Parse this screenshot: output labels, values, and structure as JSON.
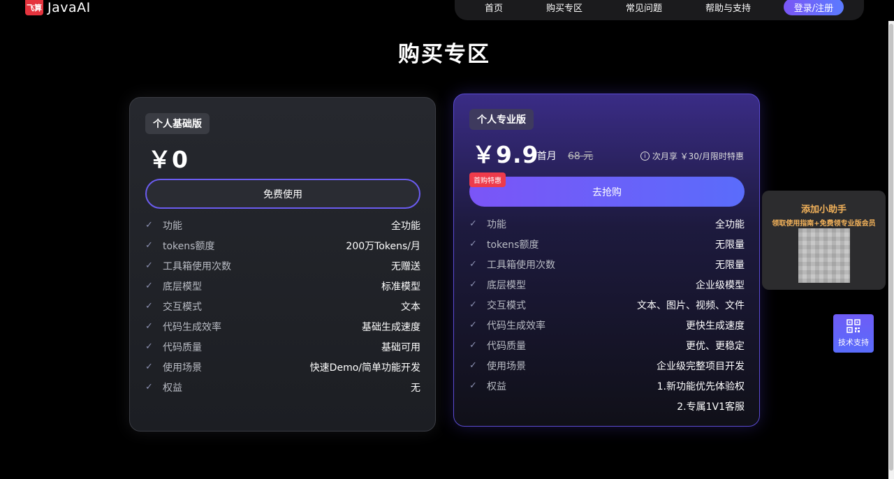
{
  "header": {
    "logo_badge": "飞算",
    "logo_text": "JavaAI",
    "nav": [
      "首页",
      "购买专区",
      "常见问题",
      "帮助与支持"
    ],
    "login_label": "登录/注册"
  },
  "page_title": "购买专区",
  "basic": {
    "tag": "个人基础版",
    "price": "￥0",
    "button": "免费使用",
    "features": [
      {
        "label": "功能",
        "value": "全功能"
      },
      {
        "label": "tokens额度",
        "value": "200万Tokens/月"
      },
      {
        "label": "工具箱使用次数",
        "value": "无赠送"
      },
      {
        "label": "底层模型",
        "value": "标准模型"
      },
      {
        "label": "交互模式",
        "value": "文本"
      },
      {
        "label": "代码生成效率",
        "value": "基础生成速度"
      },
      {
        "label": "代码质量",
        "value": "基础可用"
      },
      {
        "label": "使用场景",
        "value": "快速Demo/简单功能开发"
      },
      {
        "label": "权益",
        "value": "无"
      }
    ]
  },
  "pro": {
    "tag": "个人专业版",
    "price": "￥9.9",
    "price_unit": "/首月",
    "price_old": "68 元",
    "price_note": "次月享 ￥30/月限时特惠",
    "badge": "首购特惠",
    "button": "去抢购",
    "features": [
      {
        "label": "功能",
        "value": "全功能"
      },
      {
        "label": "tokens额度",
        "value": "无限量"
      },
      {
        "label": "工具箱使用次数",
        "value": "无限量"
      },
      {
        "label": "底层模型",
        "value": "企业级模型"
      },
      {
        "label": "交互模式",
        "value": "文本、图片、视频、文件"
      },
      {
        "label": "代码生成效率",
        "value": "更快生成速度"
      },
      {
        "label": "代码质量",
        "value": "更优、更稳定"
      },
      {
        "label": "使用场景",
        "value": "企业级完整项目开发"
      },
      {
        "label": "权益",
        "value": "1.新功能优先体验权"
      }
    ],
    "feature_extra": "2.专属1V1客服"
  },
  "helper": {
    "title": "添加小助手",
    "subtitle": "领取使用指南+免费领专业版会员"
  },
  "support": {
    "label": "技术支持"
  },
  "colors": {
    "accent": "#6b5cf0",
    "badge_red": "#ee3b4b",
    "helper_text": "#f3b25a"
  }
}
